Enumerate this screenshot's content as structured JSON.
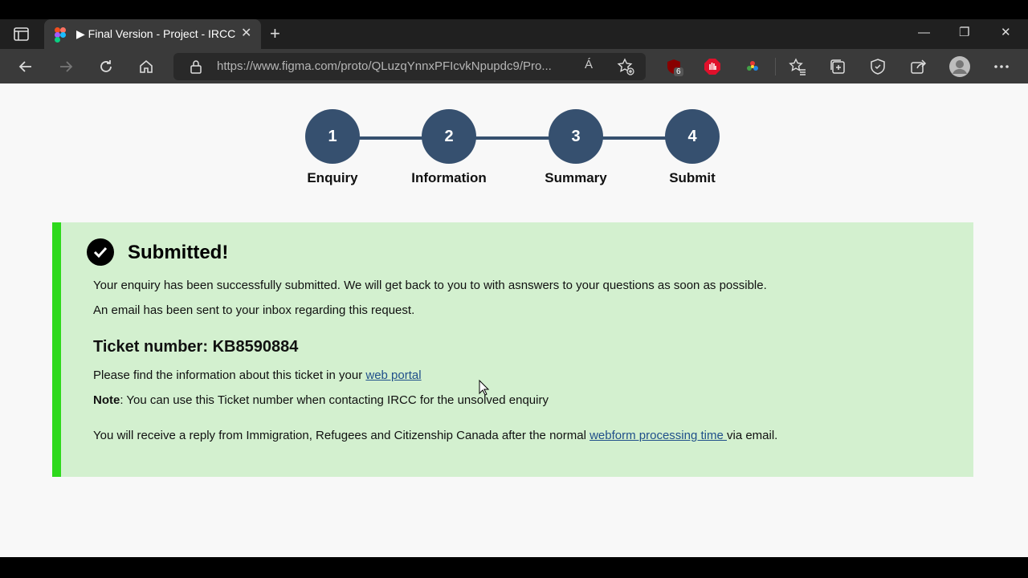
{
  "browser": {
    "tab_title": "▶ Final Version - Project - IRCC",
    "tab_close": "✕",
    "new_tab": "+",
    "url": "https://www.figma.com/proto/QLuzqYnnxPFIcvkNpupdc9/Pro...",
    "read_aloud": "Á",
    "extension_badge": "6",
    "window_minimize": "—",
    "window_restore": "❐",
    "window_close": "✕"
  },
  "stepper": {
    "steps": [
      {
        "number": "1",
        "label": "Enquiry"
      },
      {
        "number": "2",
        "label": "Information"
      },
      {
        "number": "3",
        "label": "Summary"
      },
      {
        "number": "4",
        "label": "Submit"
      }
    ]
  },
  "confirmation": {
    "title": "Submitted!",
    "message": "Your enquiry has been successfully submitted. We will get back to you to with asnswers to your questions as soon as possible.",
    "email_notice": "An email has been sent to your inbox regarding this request.",
    "ticket_label": "Ticket number: ",
    "ticket_number": "KB8590884",
    "portal_text": "Please find the information about this ticket in your ",
    "portal_link": "web portal",
    "note_label": "Note",
    "note_text": ": You can use this Ticket number when contacting IRCC for the unsolved enquiry",
    "reply_text_before": "You will receive a reply from Immigration, Refugees and Citizenship Canada after the normal ",
    "reply_link": "webform processing time ",
    "reply_text_after": "via email."
  },
  "colors": {
    "step_color": "#36506f",
    "panel_bg": "#d3f0cf",
    "panel_accent": "#2ed91c",
    "link": "#1f4f8a"
  }
}
